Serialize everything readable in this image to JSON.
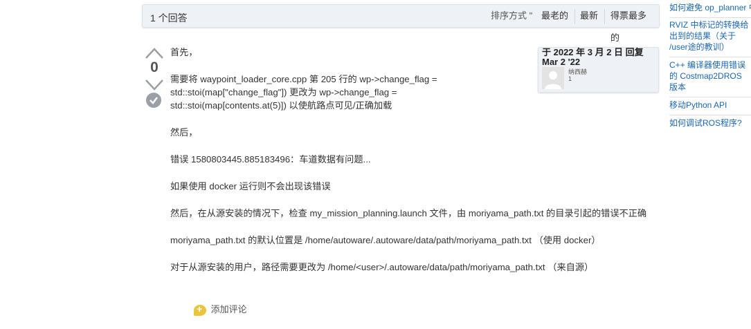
{
  "answers_header": {
    "count_label": "1 个回答",
    "sort_label": "排序方式 \"",
    "sort_options": [
      "最老的",
      "最新",
      "得票最多的"
    ]
  },
  "answer": {
    "vote_count": "0",
    "paragraphs": [
      "首先，",
      "需要将 waypoint_loader_core.cpp 第 205 行的 wp->change_flag = std::stoi(map[\"change_flag\"]) 更改为 wp->change_flag = std::stoi(map[contents.at(5)]) 以使航路点可见/正确加载",
      "然后，",
      "错误 1580803445.885183496：车道数据有问题...",
      "如果使用 docker 运行则不会出现该错误",
      "然后，在从源安装的情况下，检查 my_mission_planning.launch 文件，由 moriyama_path.txt 的目录引起的错误不正确",
      "moriyama_path.txt 的默认位置是 /home/autoware/.autoware/data/path/moriyama_path.txt （使用 docker）",
      "对于从源安装的用户，路径需要更改为 /home/<user>/.autoware/data/path/moriyama_path.txt （来自源）"
    ],
    "author_card": {
      "date_line": "于 2022 年 3 月 2 日 回复 Mar 2 '22",
      "name": "纳西赫",
      "score": "1"
    },
    "add_comment_label": "添加评论"
  },
  "related": [
    "如何避免 op_planner 中",
    "RVIZ 中标记的转换给出到的结果（关于 /user途的教训）",
    "C++ 编译器使用错误的 Costmap2DROS 版本",
    "移动Python API",
    "如何调试ROS程序?"
  ]
}
